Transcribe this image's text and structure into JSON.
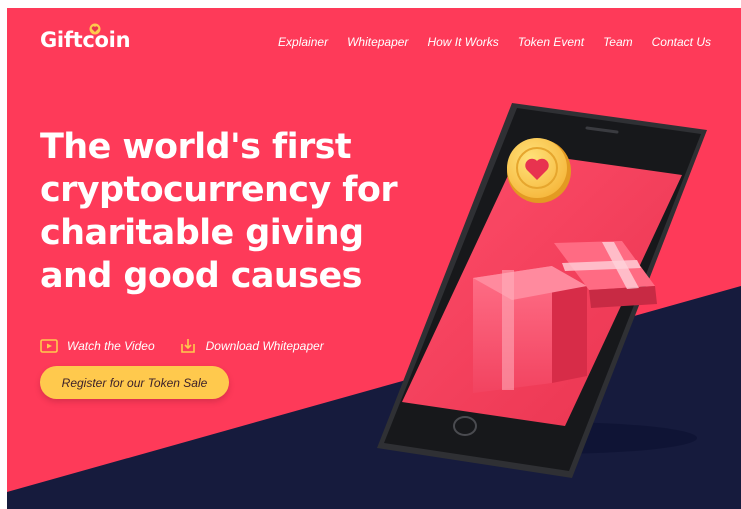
{
  "brand": {
    "name": "Giftcoin"
  },
  "nav": {
    "items": [
      {
        "id": "explainer",
        "label": "Explainer"
      },
      {
        "id": "whitepaper",
        "label": "Whitepaper"
      },
      {
        "id": "how-it-works",
        "label": "How It Works"
      },
      {
        "id": "token-event",
        "label": "Token Event"
      },
      {
        "id": "team",
        "label": "Team"
      },
      {
        "id": "contact-us",
        "label": "Contact Us"
      }
    ]
  },
  "hero": {
    "headline_lines": [
      "The world's first",
      "cryptocurrency for",
      "charitable giving",
      "and good causes"
    ],
    "links": {
      "video": {
        "label": "Watch the Video",
        "icon": "play-icon"
      },
      "whitepaper": {
        "label": "Download Whitepaper",
        "icon": "download-icon"
      }
    },
    "cta_label": "Register for our Token Sale"
  },
  "colors": {
    "primary_red": "#fe3a59",
    "navy": "#161b3d",
    "accent_yellow": "#ffc94d"
  }
}
